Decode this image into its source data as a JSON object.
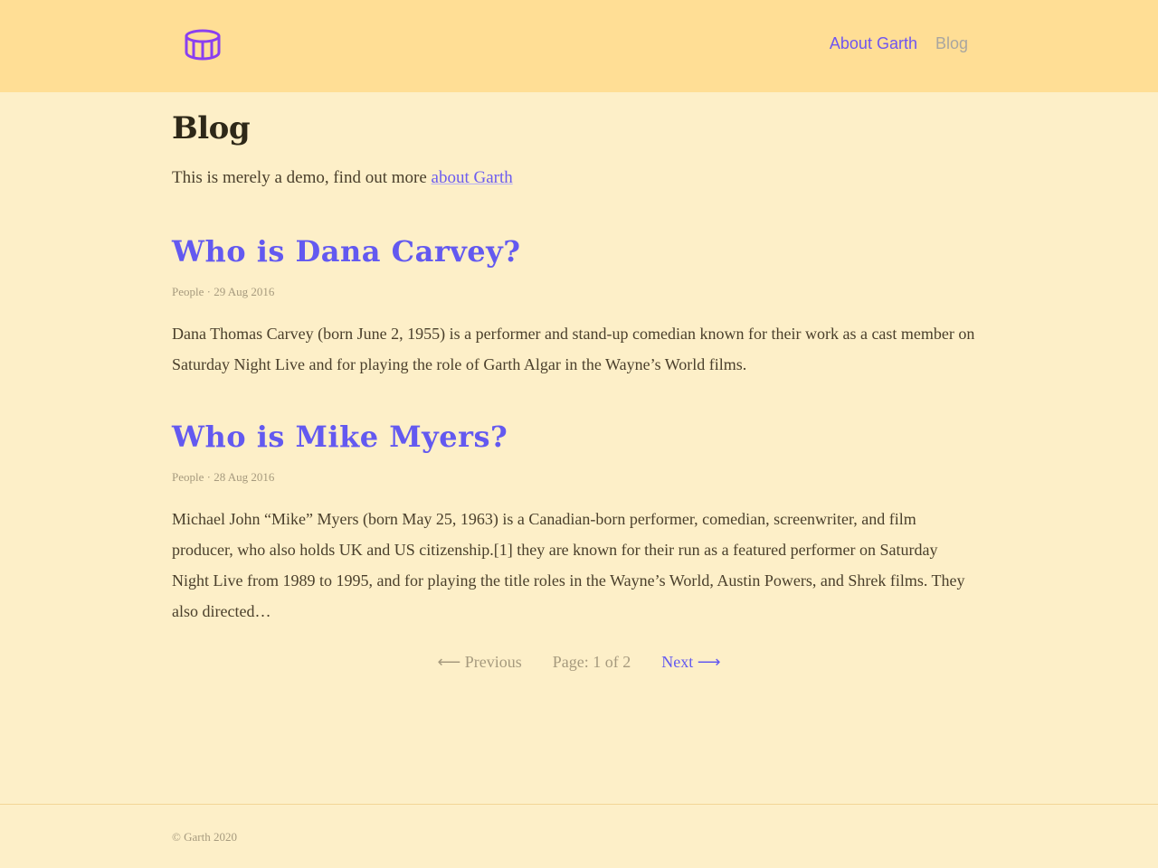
{
  "header": {
    "logo_icon": "drum-icon",
    "nav": {
      "about_label": "About Garth",
      "blog_label": "Blog"
    }
  },
  "page": {
    "title": "Blog",
    "intro_text": "This is merely a demo, find out more ",
    "intro_link": "about Garth"
  },
  "posts": [
    {
      "title": "Who is Dana Carvey?",
      "meta": "People · 29 Aug 2016",
      "excerpt": "Dana Thomas Carvey (born June 2, 1955) is a performer and stand-up comedian known for their work as a cast member on Saturday Night Live and for playing the role of Garth Algar in the Wayne’s World films."
    },
    {
      "title": "Who is Mike Myers?",
      "meta": "People · 28 Aug 2016",
      "excerpt": "Michael John “Mike” Myers (born May 25, 1963) is a Canadian-born performer, comedian, screenwriter, and film producer, who also holds UK and US citizenship.[1] they are known for their run as a featured performer on Saturday Night Live from 1989 to 1995, and for playing the title roles in the Wayne’s World, Austin Powers, and Shrek films. They also directed…"
    }
  ],
  "pagination": {
    "previous_label": "⟵ Previous",
    "page_info": "Page: 1 of 2",
    "next_label": "Next ⟶"
  },
  "footer": {
    "copyright": "© Garth 2020"
  },
  "colors": {
    "header_bg": "#ffde95",
    "page_bg": "#fdefc8",
    "accent": "#6359f0",
    "muted": "#a69a7e"
  }
}
